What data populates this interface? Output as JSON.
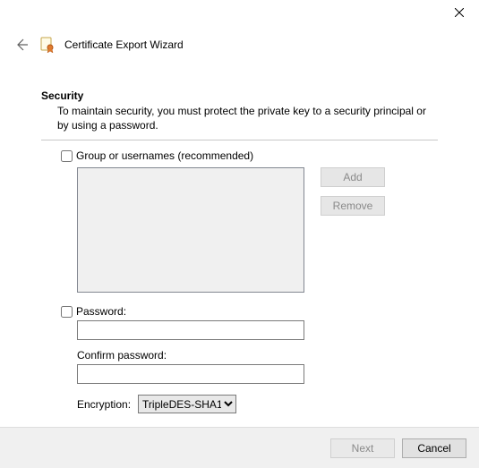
{
  "window": {
    "title": "Certificate Export Wizard"
  },
  "section": {
    "title": "Security",
    "description": "To maintain security, you must protect the private key to a security principal or by using a password."
  },
  "group_users": {
    "checkbox_label": "Group or usernames (recommended)",
    "add_label": "Add",
    "remove_label": "Remove"
  },
  "password": {
    "checkbox_label": "Password:",
    "value": "",
    "confirm_label": "Confirm password:",
    "confirm_value": ""
  },
  "encryption": {
    "label": "Encryption:",
    "selected": "TripleDES-SHA1"
  },
  "footer": {
    "next_label": "Next",
    "cancel_label": "Cancel"
  }
}
